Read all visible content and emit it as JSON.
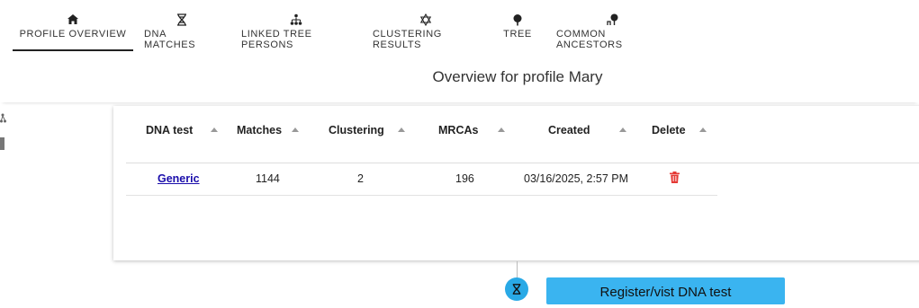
{
  "tabs": [
    {
      "label": "PROFILE OVERVIEW",
      "icon": "home-icon",
      "active": true
    },
    {
      "label": "DNA MATCHES",
      "icon": "dna-icon"
    },
    {
      "label": "LINKED TREE PERSONS",
      "icon": "family-tree-icon"
    },
    {
      "label": "CLUSTERING RESULTS",
      "icon": "hexagram-icon"
    },
    {
      "label": "TREE",
      "icon": "tree-icon"
    },
    {
      "label": "COMMON ANCESTORS",
      "icon": "ancestor-icon"
    }
  ],
  "page": {
    "title": "Overview for profile Mary"
  },
  "table": {
    "columns": [
      "DNA test",
      "Matches",
      "Clustering",
      "MRCAs",
      "Created",
      "Delete"
    ],
    "rows": [
      {
        "dna_test": "Generic",
        "matches": "1144",
        "clustering": "2",
        "mrcas": "196",
        "created": "03/16/2025, 2:57 PM",
        "delete_icon": "trash-icon"
      }
    ]
  },
  "register_button": {
    "label": "Register/vist DNA test"
  },
  "colors": {
    "accent": "#3ab4f0",
    "delete": "#e53935",
    "link": "#1a0dab"
  }
}
